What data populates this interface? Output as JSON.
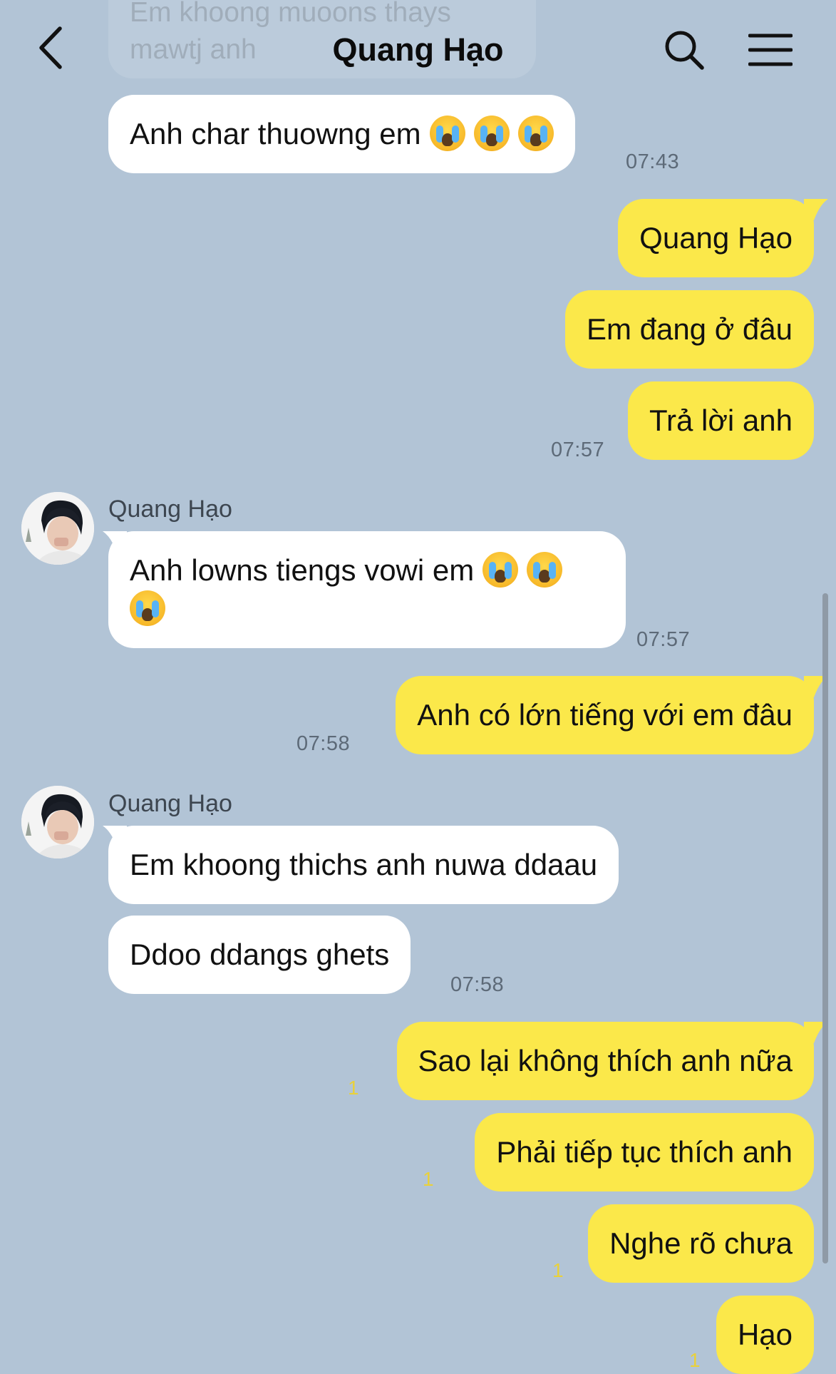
{
  "header": {
    "title": "Quang Hạo",
    "faded_prev_message": "Em khoong muoons thays mawtj anh"
  },
  "messages": {
    "m1": {
      "text": "Anh char thuowng em",
      "time": "07:43"
    },
    "m2": {
      "text": "Quang Hạo"
    },
    "m3": {
      "text": "Em đang ở đâu"
    },
    "m4": {
      "text": "Trả lời anh",
      "time": "07:57"
    },
    "g1": {
      "sender": "Quang Hạo"
    },
    "m5": {
      "text": "Anh lowns tiengs vowi em",
      "time": "07:57"
    },
    "m6": {
      "text": "Anh có lớn tiếng với em đâu",
      "time": "07:58"
    },
    "g2": {
      "sender": "Quang Hạo"
    },
    "m7": {
      "text": "Em khoong thichs anh nuwa ddaau"
    },
    "m8": {
      "text": "Ddoo ddangs ghets",
      "time": "07:58"
    },
    "m9": {
      "text": "Sao lại không thích anh nữa",
      "unread": "1"
    },
    "m10": {
      "text": "Phải tiếp tục thích anh",
      "unread": "1"
    },
    "m11": {
      "text": "Nghe rõ chưa",
      "unread": "1"
    },
    "m12": {
      "text": "Hạo",
      "unread": "1"
    }
  },
  "colors": {
    "background": "#b2c4d6",
    "outgoing_bubble": "#fbe84a",
    "incoming_bubble": "#ffffff",
    "unread_count": "#e9d13a"
  },
  "icons": [
    "back-arrow-icon",
    "search-icon",
    "menu-icon",
    "crying-emoji-icon"
  ]
}
